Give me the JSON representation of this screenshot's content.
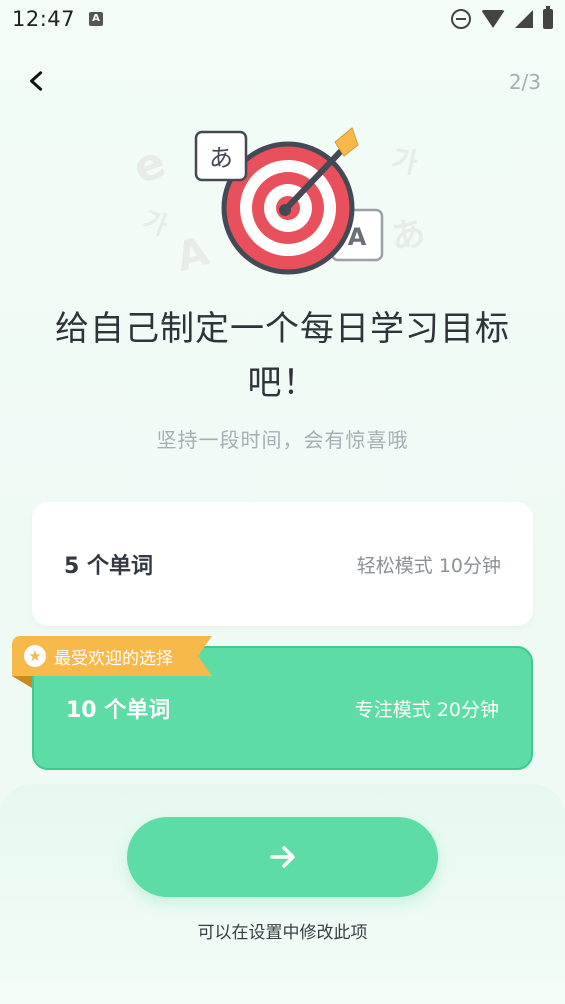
{
  "status_bar": {
    "time": "12:47",
    "app_badge": "A"
  },
  "nav": {
    "step": "2/3"
  },
  "illustration": {
    "card_hiragana": "あ",
    "card_latin": "A",
    "bg_letters": [
      "e",
      "e",
      "가",
      "가",
      "A",
      "あ"
    ]
  },
  "header": {
    "title": "给自己制定一个每日学习目标吧！",
    "subtitle": "坚持一段时间，会有惊喜哦"
  },
  "options": [
    {
      "count": "5 个单词",
      "mode": "轻松模式 10分钟",
      "selected": false
    },
    {
      "count": "10 个单词",
      "mode": "专注模式 20分钟",
      "selected": true,
      "badge": "最受欢迎的选择"
    }
  ],
  "footer": {
    "hint": "可以在设置中修改此项"
  },
  "colors": {
    "accent": "#5edca6",
    "badge": "#f8b94b",
    "target_red": "#e8505b"
  }
}
